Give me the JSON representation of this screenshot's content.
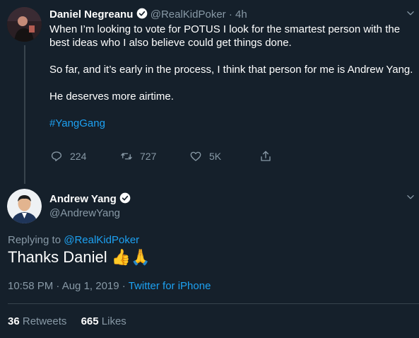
{
  "tweet1": {
    "name": "Daniel Negreanu",
    "handle": "@RealKidPoker",
    "time": "· 4h",
    "p1": "When I’m looking to vote for POTUS I look for the smartest person with the best ideas who I also believe could get things done.",
    "p2": "So far, and it’s early in the process, I think that person for me is Andrew Yang.",
    "p3": "He deserves more airtime.",
    "hashtag": "#YangGang",
    "replies": "224",
    "retweets": "727",
    "likes": "5K"
  },
  "tweet2": {
    "name": "Andrew Yang",
    "handle": "@AndrewYang",
    "replying_prefix": "Replying to",
    "replying_handle": "@RealKidPoker",
    "text": "Thanks Daniel",
    "emoji": "👍🙏",
    "timestamp": "10:58 PM · Aug 1, 2019 ·",
    "source": "Twitter for iPhone",
    "retweet_count": "36",
    "retweet_label": "Retweets",
    "like_count": "665",
    "like_label": "Likes"
  },
  "colors": {
    "background": "#15202b",
    "muted": "#8899a6",
    "accent": "#1da1f2",
    "divider": "#38444d"
  }
}
